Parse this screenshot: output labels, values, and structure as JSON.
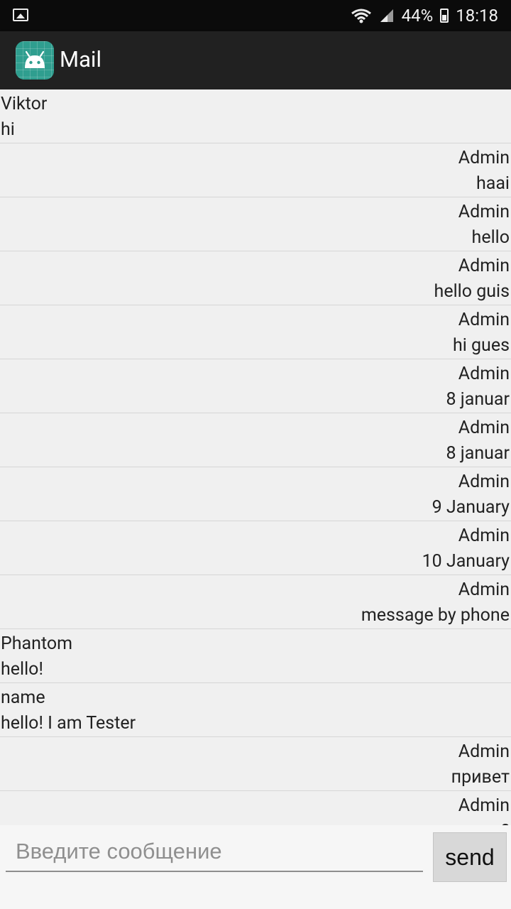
{
  "status_bar": {
    "battery": "44%",
    "time": "18:18"
  },
  "app_bar": {
    "title": "Mail",
    "icon": "android-icon"
  },
  "messages": [
    {
      "name": "Viktor",
      "text": "hi",
      "align": "left"
    },
    {
      "name": "Admin",
      "text": "haai",
      "align": "right"
    },
    {
      "name": "Admin",
      "text": "hello",
      "align": "right"
    },
    {
      "name": "Admin",
      "text": "hello guis",
      "align": "right"
    },
    {
      "name": "Admin",
      "text": "hi gues",
      "align": "right"
    },
    {
      "name": "Admin",
      "text": "8  januar",
      "align": "right"
    },
    {
      "name": "Admin",
      "text": "8  januar",
      "align": "right"
    },
    {
      "name": "Admin",
      "text": "9 January",
      "align": "right"
    },
    {
      "name": "Admin",
      "text": "10 January",
      "align": "right"
    },
    {
      "name": "Admin",
      "text": "message by phone",
      "align": "right"
    },
    {
      "name": "Phantom",
      "text": "hello!",
      "align": "left"
    },
    {
      "name": "name",
      "text": "hello! I am Tester",
      "align": "left"
    },
    {
      "name": "Admin",
      "text": "привет",
      "align": "right"
    },
    {
      "name": "Admin",
      "text": "?",
      "align": "right"
    }
  ],
  "compose": {
    "placeholder": "Введите сообщение",
    "value": "",
    "send_label": "send"
  }
}
